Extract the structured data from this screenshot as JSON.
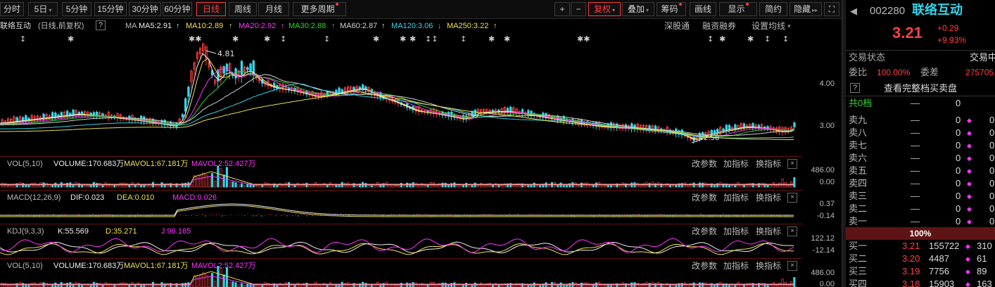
{
  "toolbar": {
    "periods": [
      "分时",
      "5日",
      "5分钟",
      "15分钟",
      "30分钟",
      "60分钟",
      "日线",
      "周线",
      "月线",
      "更多周期"
    ],
    "right": [
      "+",
      "−",
      "复权",
      "叠加",
      "筹码",
      "画线",
      "显示",
      "简约",
      "隐藏"
    ]
  },
  "ma_legend": {
    "name": "联络互动",
    "mode": "(日线,前复权)",
    "help": "?",
    "ma": "MA",
    "items": [
      {
        "label": "MA5:2.91",
        "color": "#f0f0f0"
      },
      {
        "label": "MA10:2.89",
        "color": "#f0e050"
      },
      {
        "label": "MA20:2.92",
        "color": "#ff33ff"
      },
      {
        "label": "MA30:2.88",
        "color": "#32d232"
      },
      {
        "label": "MA60:2.87",
        "color": "#d0d0d0"
      },
      {
        "label": "MA120:3.06",
        "color": "#35d4e8"
      },
      {
        "label": "MA250:3.22",
        "color": "#f0e050"
      }
    ]
  },
  "chart_tools": [
    "深股通",
    "融资融券",
    "设置均线"
  ],
  "price_axis": [
    "4.00",
    "3.00"
  ],
  "annotations": {
    "high": "4.81",
    "low": "2.58"
  },
  "panels": [
    {
      "label": "VOL(5,10)",
      "items": [
        {
          "t": "VOLUME:170.683万",
          "c": "#f0f0f0"
        },
        {
          "t": "MAVOL1:67.181万",
          "c": "#f0e050"
        },
        {
          "t": "MAVOL2:52.427万",
          "c": "#ff33ff"
        }
      ],
      "axis": [
        "486.00",
        "0.00"
      ]
    },
    {
      "label": "MACD(12,26,9)",
      "items": [
        {
          "t": "DIF:0.023",
          "c": "#f0f0f0"
        },
        {
          "t": "DEA:0.010",
          "c": "#f0e050"
        },
        {
          "t": "MACD:0.026",
          "c": "#ff33ff"
        }
      ],
      "axis": [
        "0.37",
        "-0.14"
      ]
    },
    {
      "label": "KDJ(9,3,3)",
      "items": [
        {
          "t": "K:55.569",
          "c": "#f0f0f0"
        },
        {
          "t": "D:35.271",
          "c": "#f0e050"
        },
        {
          "t": "J:96.165",
          "c": "#ff33ff"
        }
      ],
      "axis": [
        "122.12",
        "-12.14"
      ]
    },
    {
      "label": "VOL(5,10)",
      "items": [
        {
          "t": "VOLUME:170.683万",
          "c": "#f0f0f0"
        },
        {
          "t": "MAVOL1:67.181万",
          "c": "#f0e050"
        },
        {
          "t": "MAVOL2:52.427万",
          "c": "#ff33ff"
        }
      ],
      "axis": [
        "486.00",
        "0.00"
      ]
    }
  ],
  "panel_tools": [
    "改参数",
    "加指标",
    "换指标"
  ],
  "quote": {
    "code": "002280",
    "name": "联络互动",
    "price": "3.21",
    "change": "+0.29",
    "pct": "+9.93%",
    "status_label": "交易状态",
    "status_value": "交易中",
    "wb_label": "委比",
    "wb_value": "100.00%",
    "wc_label": "委差",
    "wc_value": "275705",
    "full_book": "查看完整档买卖盘",
    "total_label": "共0档",
    "pct100": "100%"
  },
  "asks": [
    {
      "l": "卖九",
      "p": "—",
      "v": "0",
      "x": "0"
    },
    {
      "l": "卖八",
      "p": "—",
      "v": "0",
      "x": "0"
    },
    {
      "l": "卖七",
      "p": "—",
      "v": "0",
      "x": "0"
    },
    {
      "l": "卖六",
      "p": "—",
      "v": "0",
      "x": "0"
    },
    {
      "l": "卖五",
      "p": "—",
      "v": "0",
      "x": "0"
    },
    {
      "l": "卖四",
      "p": "—",
      "v": "0",
      "x": "0"
    },
    {
      "l": "卖三",
      "p": "—",
      "v": "0",
      "x": "0"
    },
    {
      "l": "卖二",
      "p": "—",
      "v": "0",
      "x": "0"
    },
    {
      "l": "卖一",
      "p": "—",
      "v": "0",
      "x": "0"
    }
  ],
  "bids": [
    {
      "l": "买一",
      "p": "3.21",
      "v": "155722",
      "x": "310"
    },
    {
      "l": "买二",
      "p": "3.20",
      "v": "4487",
      "x": "61"
    },
    {
      "l": "买三",
      "p": "3.19",
      "v": "7756",
      "x": "89"
    },
    {
      "l": "买四",
      "p": "3.18",
      "v": "15903",
      "x": "163"
    }
  ]
}
